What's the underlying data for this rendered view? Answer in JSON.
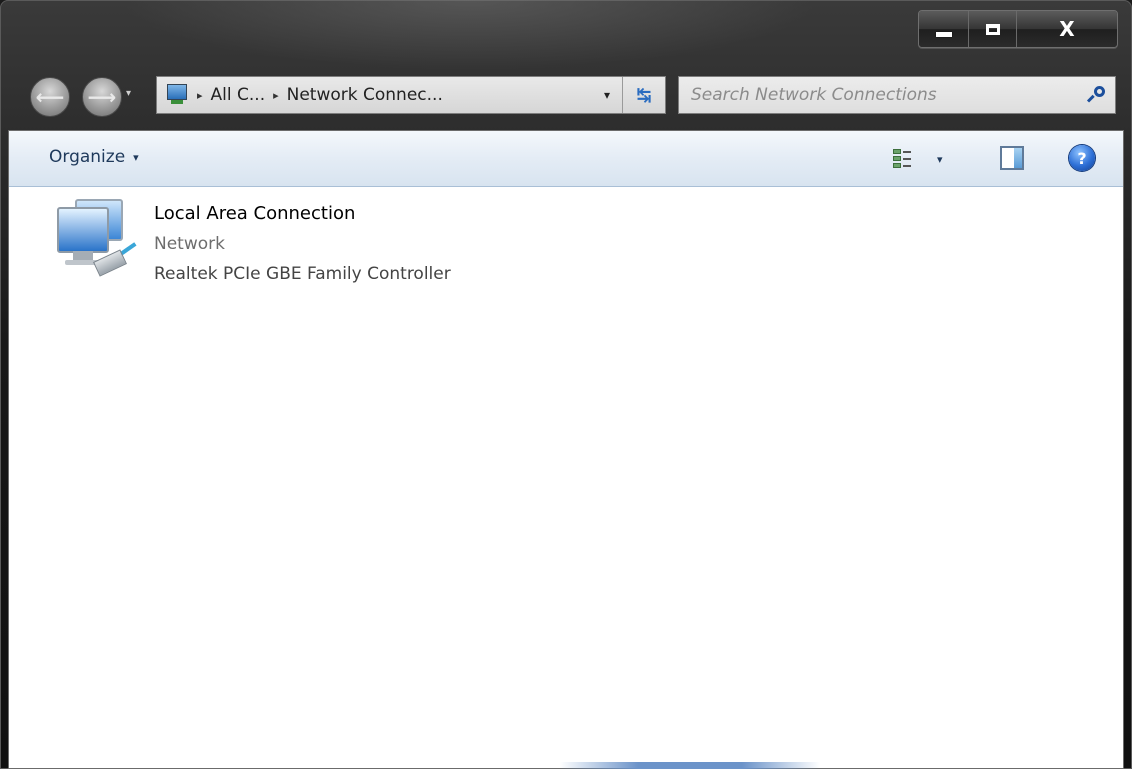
{
  "window": {
    "caption_buttons": {
      "minimize": "minimize",
      "maximize": "maximize",
      "close": "X"
    }
  },
  "nav": {
    "back_icon": "back-arrow-icon",
    "forward_icon": "forward-arrow-icon",
    "history_dropdown": "▾"
  },
  "address_bar": {
    "breadcrumbs": [
      "All C...",
      "Network Connec..."
    ],
    "separator": "▸",
    "dropdown": "▾",
    "refresh_icon": "refresh-icon"
  },
  "search": {
    "placeholder": "Search Network Connections"
  },
  "toolbar": {
    "organize_label": "Organize",
    "dropdown": "▾",
    "help": "?"
  },
  "items": [
    {
      "name": "Local Area Connection",
      "status": "Network",
      "device": "Realtek PCIe GBE Family Controller"
    }
  ]
}
